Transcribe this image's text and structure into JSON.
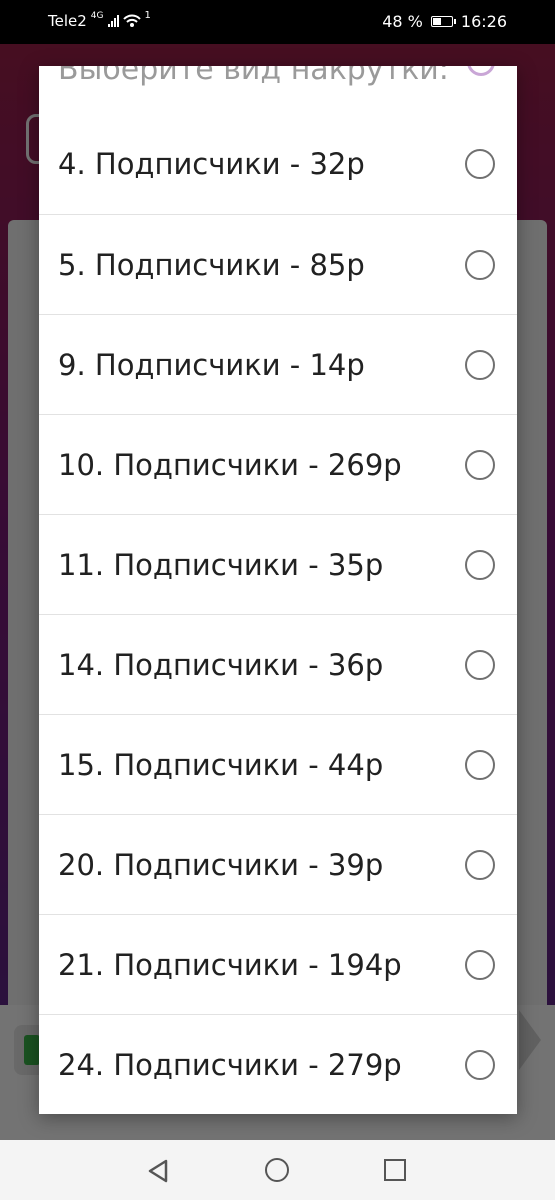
{
  "status_bar": {
    "carrier": "Tele2",
    "network_type": "4G",
    "sim_indicator": "1",
    "battery": "48 %",
    "battery_level": 0.48,
    "time": "16:26"
  },
  "dialog": {
    "title": "Выберите вид накрутки:",
    "options": [
      {
        "label": "4. Подписчики - 32р"
      },
      {
        "label": "5. Подписчики - 85р"
      },
      {
        "label": "9. Подписчики - 14р"
      },
      {
        "label": "10. Подписчики - 269р"
      },
      {
        "label": "11. Подписчики - 35р"
      },
      {
        "label": "14. Подписчики - 36р"
      },
      {
        "label": "15. Подписчики - 44р"
      },
      {
        "label": "20. Подписчики - 39р"
      },
      {
        "label": "21. Подписчики - 194р"
      },
      {
        "label": "24. Подписчики - 279р"
      }
    ]
  },
  "colors": {
    "accent": "#c9a6d6",
    "radio_border": "#707070",
    "text": "#212121"
  },
  "icons": {
    "back": "back-triangle-icon",
    "home": "home-circle-icon",
    "recent": "recent-square-icon"
  }
}
